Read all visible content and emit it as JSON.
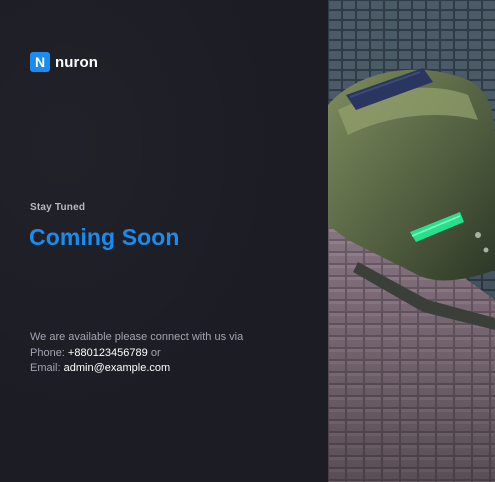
{
  "brand": {
    "logo_letter": "N",
    "name": "nuron",
    "accent": "#1a8cf0"
  },
  "hero": {
    "eyebrow": "Stay Tuned",
    "title": "Coming Soon"
  },
  "contact": {
    "intro": "We are available please connect with us via",
    "phone_label": "Phone: ",
    "phone_value": "+880123456789",
    "phone_suffix": " or",
    "email_label": "Email: ",
    "email_value": "admin@example.com"
  },
  "side_image": {
    "description_icon": "sneaker-photo"
  }
}
